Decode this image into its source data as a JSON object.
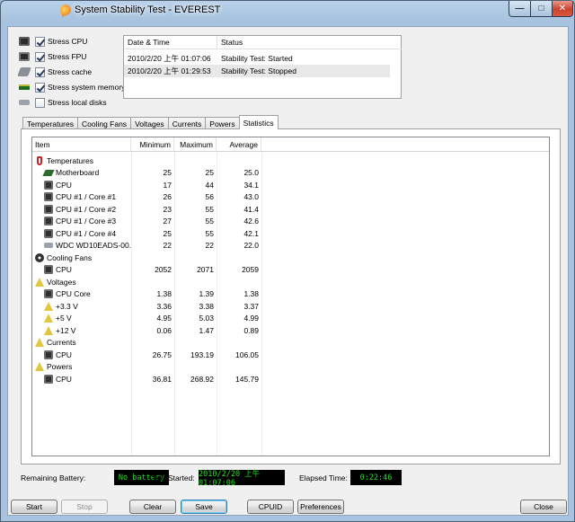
{
  "window": {
    "title": "System Stability Test - EVEREST",
    "minimize_glyph": "—",
    "maximize_glyph": "□",
    "close_glyph": "✕"
  },
  "stress": [
    {
      "label": "Stress CPU",
      "checked": true,
      "icon": "cpu-icon"
    },
    {
      "label": "Stress FPU",
      "checked": true,
      "icon": "fpu-icon"
    },
    {
      "label": "Stress cache",
      "checked": true,
      "icon": "cache-icon"
    },
    {
      "label": "Stress system memory",
      "checked": true,
      "icon": "memory-icon"
    },
    {
      "label": "Stress local disks",
      "checked": false,
      "icon": "disk-icon"
    }
  ],
  "log": {
    "headers": {
      "date": "Date & Time",
      "status": "Status"
    },
    "rows": [
      {
        "date": "2010/2/20 上午 01:07:06",
        "status": "Stability Test: Started"
      },
      {
        "date": "2010/2/20 上午 01:29:53",
        "status": "Stability Test: Stopped"
      }
    ]
  },
  "tabs": [
    "Temperatures",
    "Cooling Fans",
    "Voltages",
    "Currents",
    "Powers",
    "Statistics"
  ],
  "active_tab": "Statistics",
  "stats": {
    "headers": {
      "item": "Item",
      "min": "Minimum",
      "max": "Maximum",
      "avg": "Average"
    },
    "rows": [
      {
        "type": "group",
        "item": "Temperatures",
        "icon": "thermometer-icon"
      },
      {
        "type": "item",
        "item": "Motherboard",
        "min": "25",
        "max": "25",
        "avg": "25.0",
        "icon": "motherboard-icon"
      },
      {
        "type": "item",
        "item": "CPU",
        "min": "17",
        "max": "44",
        "avg": "34.1",
        "icon": "chip-icon"
      },
      {
        "type": "item",
        "item": "CPU #1 / Core #1",
        "min": "26",
        "max": "56",
        "avg": "43.0",
        "icon": "chip-icon"
      },
      {
        "type": "item",
        "item": "CPU #1 / Core #2",
        "min": "23",
        "max": "55",
        "avg": "41.4",
        "icon": "chip-icon"
      },
      {
        "type": "item",
        "item": "CPU #1 / Core #3",
        "min": "27",
        "max": "55",
        "avg": "42.6",
        "icon": "chip-icon"
      },
      {
        "type": "item",
        "item": "CPU #1 / Core #4",
        "min": "25",
        "max": "55",
        "avg": "42.1",
        "icon": "chip-icon"
      },
      {
        "type": "item",
        "item": "WDC WD10EADS-00...",
        "min": "22",
        "max": "22",
        "avg": "22.0",
        "icon": "disk-icon"
      },
      {
        "type": "group",
        "item": "Cooling Fans",
        "icon": "fan-icon"
      },
      {
        "type": "item",
        "item": "CPU",
        "min": "2052",
        "max": "2071",
        "avg": "2059",
        "icon": "chip-icon"
      },
      {
        "type": "group",
        "item": "Voltages",
        "icon": "warning-icon"
      },
      {
        "type": "item",
        "item": "CPU Core",
        "min": "1.38",
        "max": "1.39",
        "avg": "1.38",
        "icon": "chip-icon"
      },
      {
        "type": "item",
        "item": "+3.3 V",
        "min": "3.36",
        "max": "3.38",
        "avg": "3.37",
        "icon": "warning-icon"
      },
      {
        "type": "item",
        "item": "+5 V",
        "min": "4.95",
        "max": "5.03",
        "avg": "4.99",
        "icon": "warning-icon"
      },
      {
        "type": "item",
        "item": "+12 V",
        "min": "0.06",
        "max": "1.47",
        "avg": "0.89",
        "icon": "warning-icon"
      },
      {
        "type": "group",
        "item": "Currents",
        "icon": "warning-icon"
      },
      {
        "type": "item",
        "item": "CPU",
        "min": "26.75",
        "max": "193.19",
        "avg": "106.05",
        "icon": "chip-icon"
      },
      {
        "type": "group",
        "item": "Powers",
        "icon": "warning-icon"
      },
      {
        "type": "item",
        "item": "CPU",
        "min": "36.81",
        "max": "268.92",
        "avg": "145.79",
        "icon": "chip-icon"
      }
    ]
  },
  "status": {
    "battery_label": "Remaining Battery:",
    "battery_value": "No battery",
    "started_label": "Test Started:",
    "started_value": "2010/2/20 上午 01:07:06",
    "elapsed_label": "Elapsed Time:",
    "elapsed_value": "0:22:46"
  },
  "buttons": {
    "start": "Start",
    "stop": "Stop",
    "clear": "Clear",
    "save": "Save",
    "cpuid": "CPUID",
    "preferences": "Preferences",
    "close": "Close"
  },
  "colors": {
    "lcd_text": "#20e020",
    "lcd_bg": "#000000"
  }
}
